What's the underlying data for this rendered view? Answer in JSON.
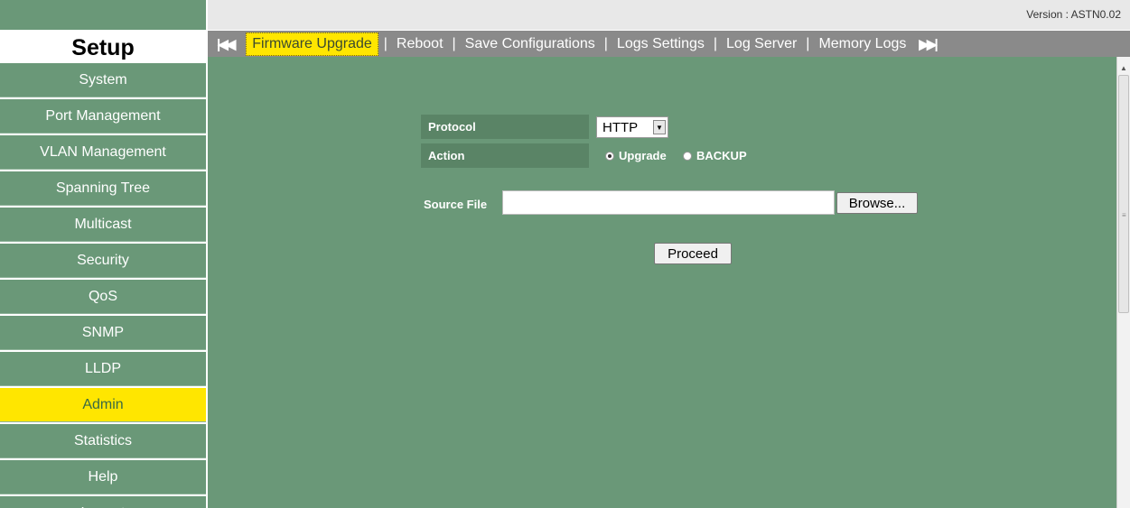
{
  "version": {
    "text": "Version : ASTN0.02"
  },
  "header": {
    "title": "Setup"
  },
  "sidebar": {
    "items": [
      {
        "label": "System"
      },
      {
        "label": "Port Management"
      },
      {
        "label": "VLAN Management"
      },
      {
        "label": "Spanning Tree"
      },
      {
        "label": "Multicast"
      },
      {
        "label": "Security"
      },
      {
        "label": "QoS"
      },
      {
        "label": "SNMP"
      },
      {
        "label": "LLDP"
      },
      {
        "label": "Admin",
        "active": true
      },
      {
        "label": "Statistics"
      },
      {
        "label": "Help"
      },
      {
        "label": "Logout"
      }
    ]
  },
  "tabs": {
    "first_icon": "skip-first-icon",
    "last_icon": "skip-last-icon",
    "items": [
      {
        "label": "Firmware Upgrade",
        "active": true
      },
      {
        "label": "Reboot"
      },
      {
        "label": "Save Configurations"
      },
      {
        "label": "Logs Settings"
      },
      {
        "label": "Log Server"
      },
      {
        "label": "Memory Logs"
      }
    ],
    "separator": "|"
  },
  "form": {
    "protocol_label": "Protocol",
    "protocol_value": "HTTP",
    "action_label": "Action",
    "action_options": [
      {
        "label": "Upgrade",
        "selected": true
      },
      {
        "label": "BACKUP",
        "selected": false
      }
    ],
    "source_label": "Source File",
    "source_value": "",
    "browse_label": "Browse...",
    "proceed_label": "Proceed"
  },
  "colors": {
    "sidebar_bg": "#6a9878",
    "highlight": "#ffe600",
    "tabbar_bg": "#8a8a8a",
    "content_bg": "#6a9878"
  }
}
